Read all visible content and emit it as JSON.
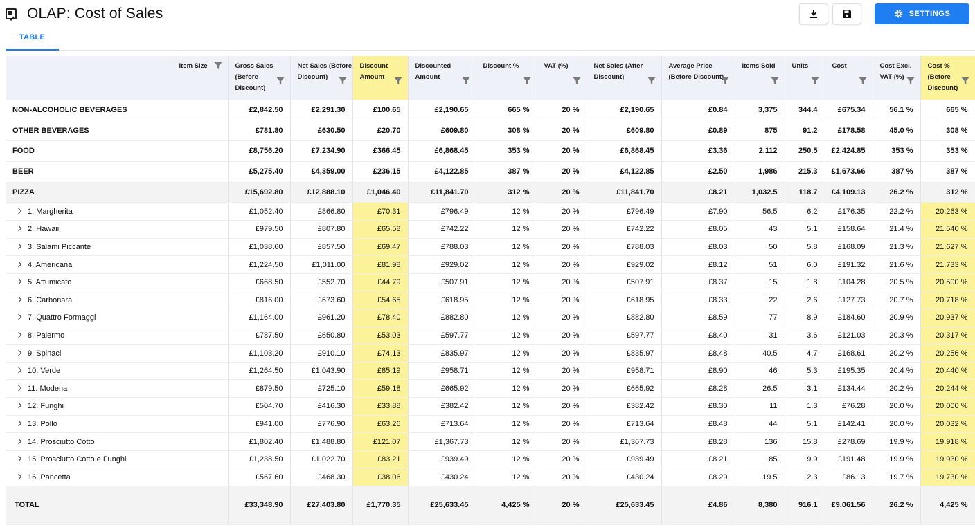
{
  "title": "OLAP: Cost of Sales",
  "settings_label": "SETTINGS",
  "tabs": [
    {
      "label": "TABLE"
    }
  ],
  "colors": {
    "accent": "#1e7ef2",
    "highlight": "#fbf29a",
    "header_bg": "#eef2f8"
  },
  "icons": {
    "app": "report-icon",
    "download": "download-icon",
    "save": "save-icon",
    "settings": "gear-icon",
    "filter": "filter-icon",
    "expand": "chevron-right-icon"
  },
  "columns": [
    {
      "label": "",
      "highlight": false,
      "filter": false
    },
    {
      "label": "Item Size",
      "highlight": false,
      "filter": true
    },
    {
      "label": "Gross Sales (Before Discount)",
      "highlight": false,
      "filter": true
    },
    {
      "label": "Net Sales (Before Discount)",
      "highlight": false,
      "filter": true
    },
    {
      "label": "Discount Amount",
      "highlight": true,
      "filter": true
    },
    {
      "label": "Discounted Amount",
      "highlight": false,
      "filter": true
    },
    {
      "label": "Discount %",
      "highlight": false,
      "filter": true
    },
    {
      "label": "VAT (%)",
      "highlight": false,
      "filter": true
    },
    {
      "label": "Net Sales (After Discount)",
      "highlight": false,
      "filter": true
    },
    {
      "label": "Average Price (Before Discount)",
      "highlight": false,
      "filter": true
    },
    {
      "label": "Items Sold",
      "highlight": false,
      "filter": true
    },
    {
      "label": "Units",
      "highlight": false,
      "filter": true
    },
    {
      "label": "Cost",
      "highlight": false,
      "filter": true
    },
    {
      "label": "Cost Excl. VAT (%)",
      "highlight": false,
      "filter": true
    },
    {
      "label": "Cost % (Before Discount)",
      "highlight": true,
      "filter": true
    }
  ],
  "categories": [
    {
      "label": "NON-ALCOHOLIC BEVERAGES",
      "values": [
        "£2,842.50",
        "£2,291.30",
        "£100.65",
        "£2,190.65",
        "665 %",
        "20 %",
        "£2,190.65",
        "£0.84",
        "3,375",
        "344.4",
        "£675.34",
        "56.1 %",
        "665 %"
      ]
    },
    {
      "label": "OTHER BEVERAGES",
      "values": [
        "£781.80",
        "£630.50",
        "£20.70",
        "£609.80",
        "308 %",
        "20 %",
        "£609.80",
        "£0.89",
        "875",
        "91.2",
        "£178.58",
        "45.0 %",
        "308 %"
      ]
    },
    {
      "label": "FOOD",
      "values": [
        "£8,756.20",
        "£7,234.90",
        "£366.45",
        "£6,868.45",
        "353 %",
        "20 %",
        "£6,868.45",
        "£3.36",
        "2,112",
        "250.5",
        "£2,424.85",
        "353 %",
        "353 %"
      ]
    },
    {
      "label": "BEER",
      "values": [
        "£5,275.40",
        "£4,359.00",
        "£236.15",
        "£4,122.85",
        "387 %",
        "20 %",
        "£4,122.85",
        "£2.50",
        "1,986",
        "215.3",
        "£1,673.66",
        "387 %",
        "387 %"
      ]
    },
    {
      "label": "PIZZA",
      "values": [
        "£15,692.80",
        "£12,888.10",
        "£1,046.40",
        "£11,841.70",
        "312 %",
        "20 %",
        "£11,841.70",
        "£8.21",
        "1,032.5",
        "118.7",
        "£4,109.13",
        "26.2 %",
        "312 %"
      ]
    }
  ],
  "items": [
    {
      "label": "1. Margherita",
      "values": [
        "£1,052.40",
        "£866.80",
        "£70.31",
        "£796.49",
        "12 %",
        "20 %",
        "£796.49",
        "£7.90",
        "56.5",
        "6.2",
        "£176.35",
        "22.2 %",
        "20.263 %"
      ]
    },
    {
      "label": "2. Hawaii",
      "values": [
        "£979.50",
        "£807.80",
        "£65.58",
        "£742.22",
        "12 %",
        "20 %",
        "£742.22",
        "£8.05",
        "43",
        "5.1",
        "£158.64",
        "21.4 %",
        "21.540 %"
      ]
    },
    {
      "label": "3. Salami Piccante",
      "values": [
        "£1,038.60",
        "£857.50",
        "£69.47",
        "£788.03",
        "12 %",
        "20 %",
        "£788.03",
        "£8.03",
        "50",
        "5.8",
        "£168.09",
        "21.3 %",
        "21.627 %"
      ]
    },
    {
      "label": "4. Americana",
      "values": [
        "£1,224.50",
        "£1,011.00",
        "£81.98",
        "£929.02",
        "12 %",
        "20 %",
        "£929.02",
        "£8.12",
        "51",
        "6.0",
        "£191.32",
        "21.6 %",
        "21.733 %"
      ]
    },
    {
      "label": "5. Affumicato",
      "values": [
        "£668.50",
        "£552.70",
        "£44.79",
        "£507.91",
        "12 %",
        "20 %",
        "£507.91",
        "£8.37",
        "15",
        "1.8",
        "£104.28",
        "20.5 %",
        "20.500 %"
      ]
    },
    {
      "label": "6. Carbonara",
      "values": [
        "£816.00",
        "£673.60",
        "£54.65",
        "£618.95",
        "12 %",
        "20 %",
        "£618.95",
        "£8.33",
        "22",
        "2.6",
        "£127.73",
        "20.7 %",
        "20.718 %"
      ]
    },
    {
      "label": "7. Quattro Formaggi",
      "values": [
        "£1,164.00",
        "£961.20",
        "£78.40",
        "£882.80",
        "12 %",
        "20 %",
        "£882.80",
        "£8.59",
        "77",
        "8.9",
        "£184.60",
        "20.9 %",
        "20.937 %"
      ]
    },
    {
      "label": "8. Palermo",
      "values": [
        "£787.50",
        "£650.80",
        "£53.03",
        "£597.77",
        "12 %",
        "20 %",
        "£597.77",
        "£8.40",
        "31",
        "3.6",
        "£121.03",
        "20.3 %",
        "20.317 %"
      ]
    },
    {
      "label": "9. Spinaci",
      "values": [
        "£1,103.20",
        "£910.10",
        "£74.13",
        "£835.97",
        "12 %",
        "20 %",
        "£835.97",
        "£8.48",
        "40.5",
        "4.7",
        "£168.61",
        "20.2 %",
        "20.256 %"
      ]
    },
    {
      "label": "10. Verde",
      "values": [
        "£1,264.50",
        "£1,043.90",
        "£85.19",
        "£958.71",
        "12 %",
        "20 %",
        "£958.71",
        "£8.90",
        "46",
        "5.3",
        "£195.35",
        "20.4 %",
        "20.440 %"
      ]
    },
    {
      "label": "11. Modena",
      "values": [
        "£879.50",
        "£725.10",
        "£59.18",
        "£665.92",
        "12 %",
        "20 %",
        "£665.92",
        "£8.28",
        "26.5",
        "3.1",
        "£134.44",
        "20.2 %",
        "20.244 %"
      ]
    },
    {
      "label": "12. Funghi",
      "values": [
        "£504.70",
        "£416.30",
        "£33.88",
        "£382.42",
        "12 %",
        "20 %",
        "£382.42",
        "£8.30",
        "11",
        "1.3",
        "£76.28",
        "20.0 %",
        "20.000 %"
      ]
    },
    {
      "label": "13. Pollo",
      "values": [
        "£941.00",
        "£776.90",
        "£63.26",
        "£713.64",
        "12 %",
        "20 %",
        "£713.64",
        "£8.48",
        "44",
        "5.1",
        "£142.41",
        "20.0 %",
        "20.032 %"
      ]
    },
    {
      "label": "14. Prosciutto Cotto",
      "values": [
        "£1,802.40",
        "£1,488.80",
        "£121.07",
        "£1,367.73",
        "12 %",
        "20 %",
        "£1,367.73",
        "£8.28",
        "136",
        "15.8",
        "£278.69",
        "19.9 %",
        "19.918 %"
      ]
    },
    {
      "label": "15. Prosciutto Cotto e Funghi",
      "values": [
        "£1,238.50",
        "£1,022.70",
        "£83.21",
        "£939.49",
        "12 %",
        "20 %",
        "£939.49",
        "£8.21",
        "85",
        "9.9",
        "£191.48",
        "19.9 %",
        "19.930 %"
      ]
    },
    {
      "label": "16. Pancetta",
      "values": [
        "£567.60",
        "£468.30",
        "£38.06",
        "£430.24",
        "12 %",
        "20 %",
        "£430.24",
        "£8.29",
        "19.5",
        "2.3",
        "£86.13",
        "19.7 %",
        "19.730 %"
      ]
    }
  ],
  "total": {
    "label": "TOTAL",
    "values": [
      "£33,348.90",
      "£27,403.80",
      "£1,770.35",
      "£25,633.45",
      "4,425 %",
      "20 %",
      "£25,633.45",
      "£4.86",
      "8,380",
      "916.1",
      "£9,061.56",
      "26.2 %",
      "4,425 %"
    ]
  }
}
